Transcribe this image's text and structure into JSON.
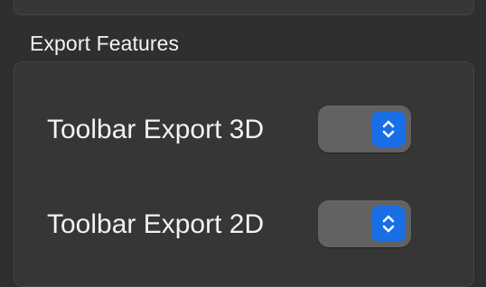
{
  "section": {
    "title": "Export Features"
  },
  "rows": [
    {
      "label": "Toolbar Export 3D",
      "value": "",
      "icon": "chevron-up-down-icon"
    },
    {
      "label": "Toolbar Export 2D",
      "value": "",
      "icon": "chevron-up-down-icon"
    }
  ],
  "colors": {
    "background": "#2f2f2f",
    "panel": "#363636",
    "popup": "#626262",
    "accent": "#1a6fe6"
  }
}
